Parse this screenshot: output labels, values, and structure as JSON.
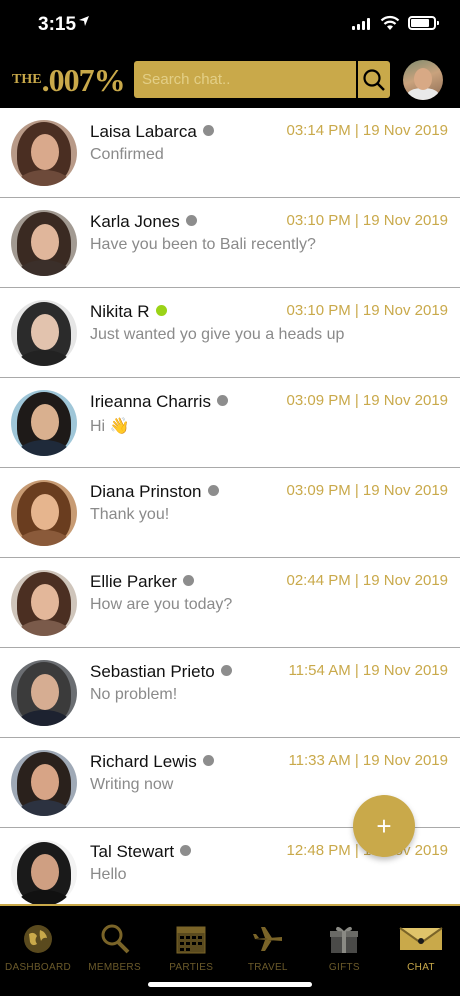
{
  "status_bar": {
    "time": "3:15",
    "location_icon": "location-arrow-icon"
  },
  "header": {
    "logo_the": "THE",
    "logo_number": ".007%",
    "search_placeholder": "Search chat..",
    "search_icon": "search-icon"
  },
  "chats": [
    {
      "name": "Laisa Labarca",
      "status": "offline",
      "time": "03:14 PM | 19 Nov 2019",
      "message": "Confirmed"
    },
    {
      "name": "Karla Jones",
      "status": "offline",
      "time": "03:10 PM | 19 Nov 2019",
      "message": "Have you been to Bali recently?"
    },
    {
      "name": "Nikita R",
      "status": "online",
      "time": "03:10 PM | 19 Nov 2019",
      "message": "Just wanted yo give you a heads up"
    },
    {
      "name": "Irieanna Charris",
      "status": "offline",
      "time": "03:09 PM | 19 Nov 2019",
      "message": "Hi 👋"
    },
    {
      "name": "Diana Prinston",
      "status": "offline",
      "time": "03:09 PM | 19 Nov 2019",
      "message": "Thank you!"
    },
    {
      "name": "Ellie Parker",
      "status": "offline",
      "time": "02:44 PM | 19 Nov 2019",
      "message": "How are you today?"
    },
    {
      "name": "Sebastian Prieto",
      "status": "offline",
      "time": "11:54 AM | 19 Nov 2019",
      "message": "No problem!"
    },
    {
      "name": "Richard Lewis",
      "status": "offline",
      "time": "11:33 AM | 19 Nov 2019",
      "message": "Writing now"
    },
    {
      "name": "Tal Stewart",
      "status": "offline",
      "time": "12:48 PM | 19 Nov 2019",
      "message": "Hello"
    }
  ],
  "fab_label": "+",
  "nav": [
    {
      "label": "DASHBOARD",
      "icon": "globe-icon"
    },
    {
      "label": "MEMBERS",
      "icon": "magnifier-icon"
    },
    {
      "label": "PARTIES",
      "icon": "calendar-icon"
    },
    {
      "label": "TRAVEL",
      "icon": "airplane-icon"
    },
    {
      "label": "GIFTS",
      "icon": "gift-box-icon"
    },
    {
      "label": "CHAT",
      "icon": "envelope-icon",
      "active": true
    }
  ],
  "colors": {
    "accent": "#c9a94a",
    "online": "#9bd317",
    "offline": "#8d8d8d"
  }
}
